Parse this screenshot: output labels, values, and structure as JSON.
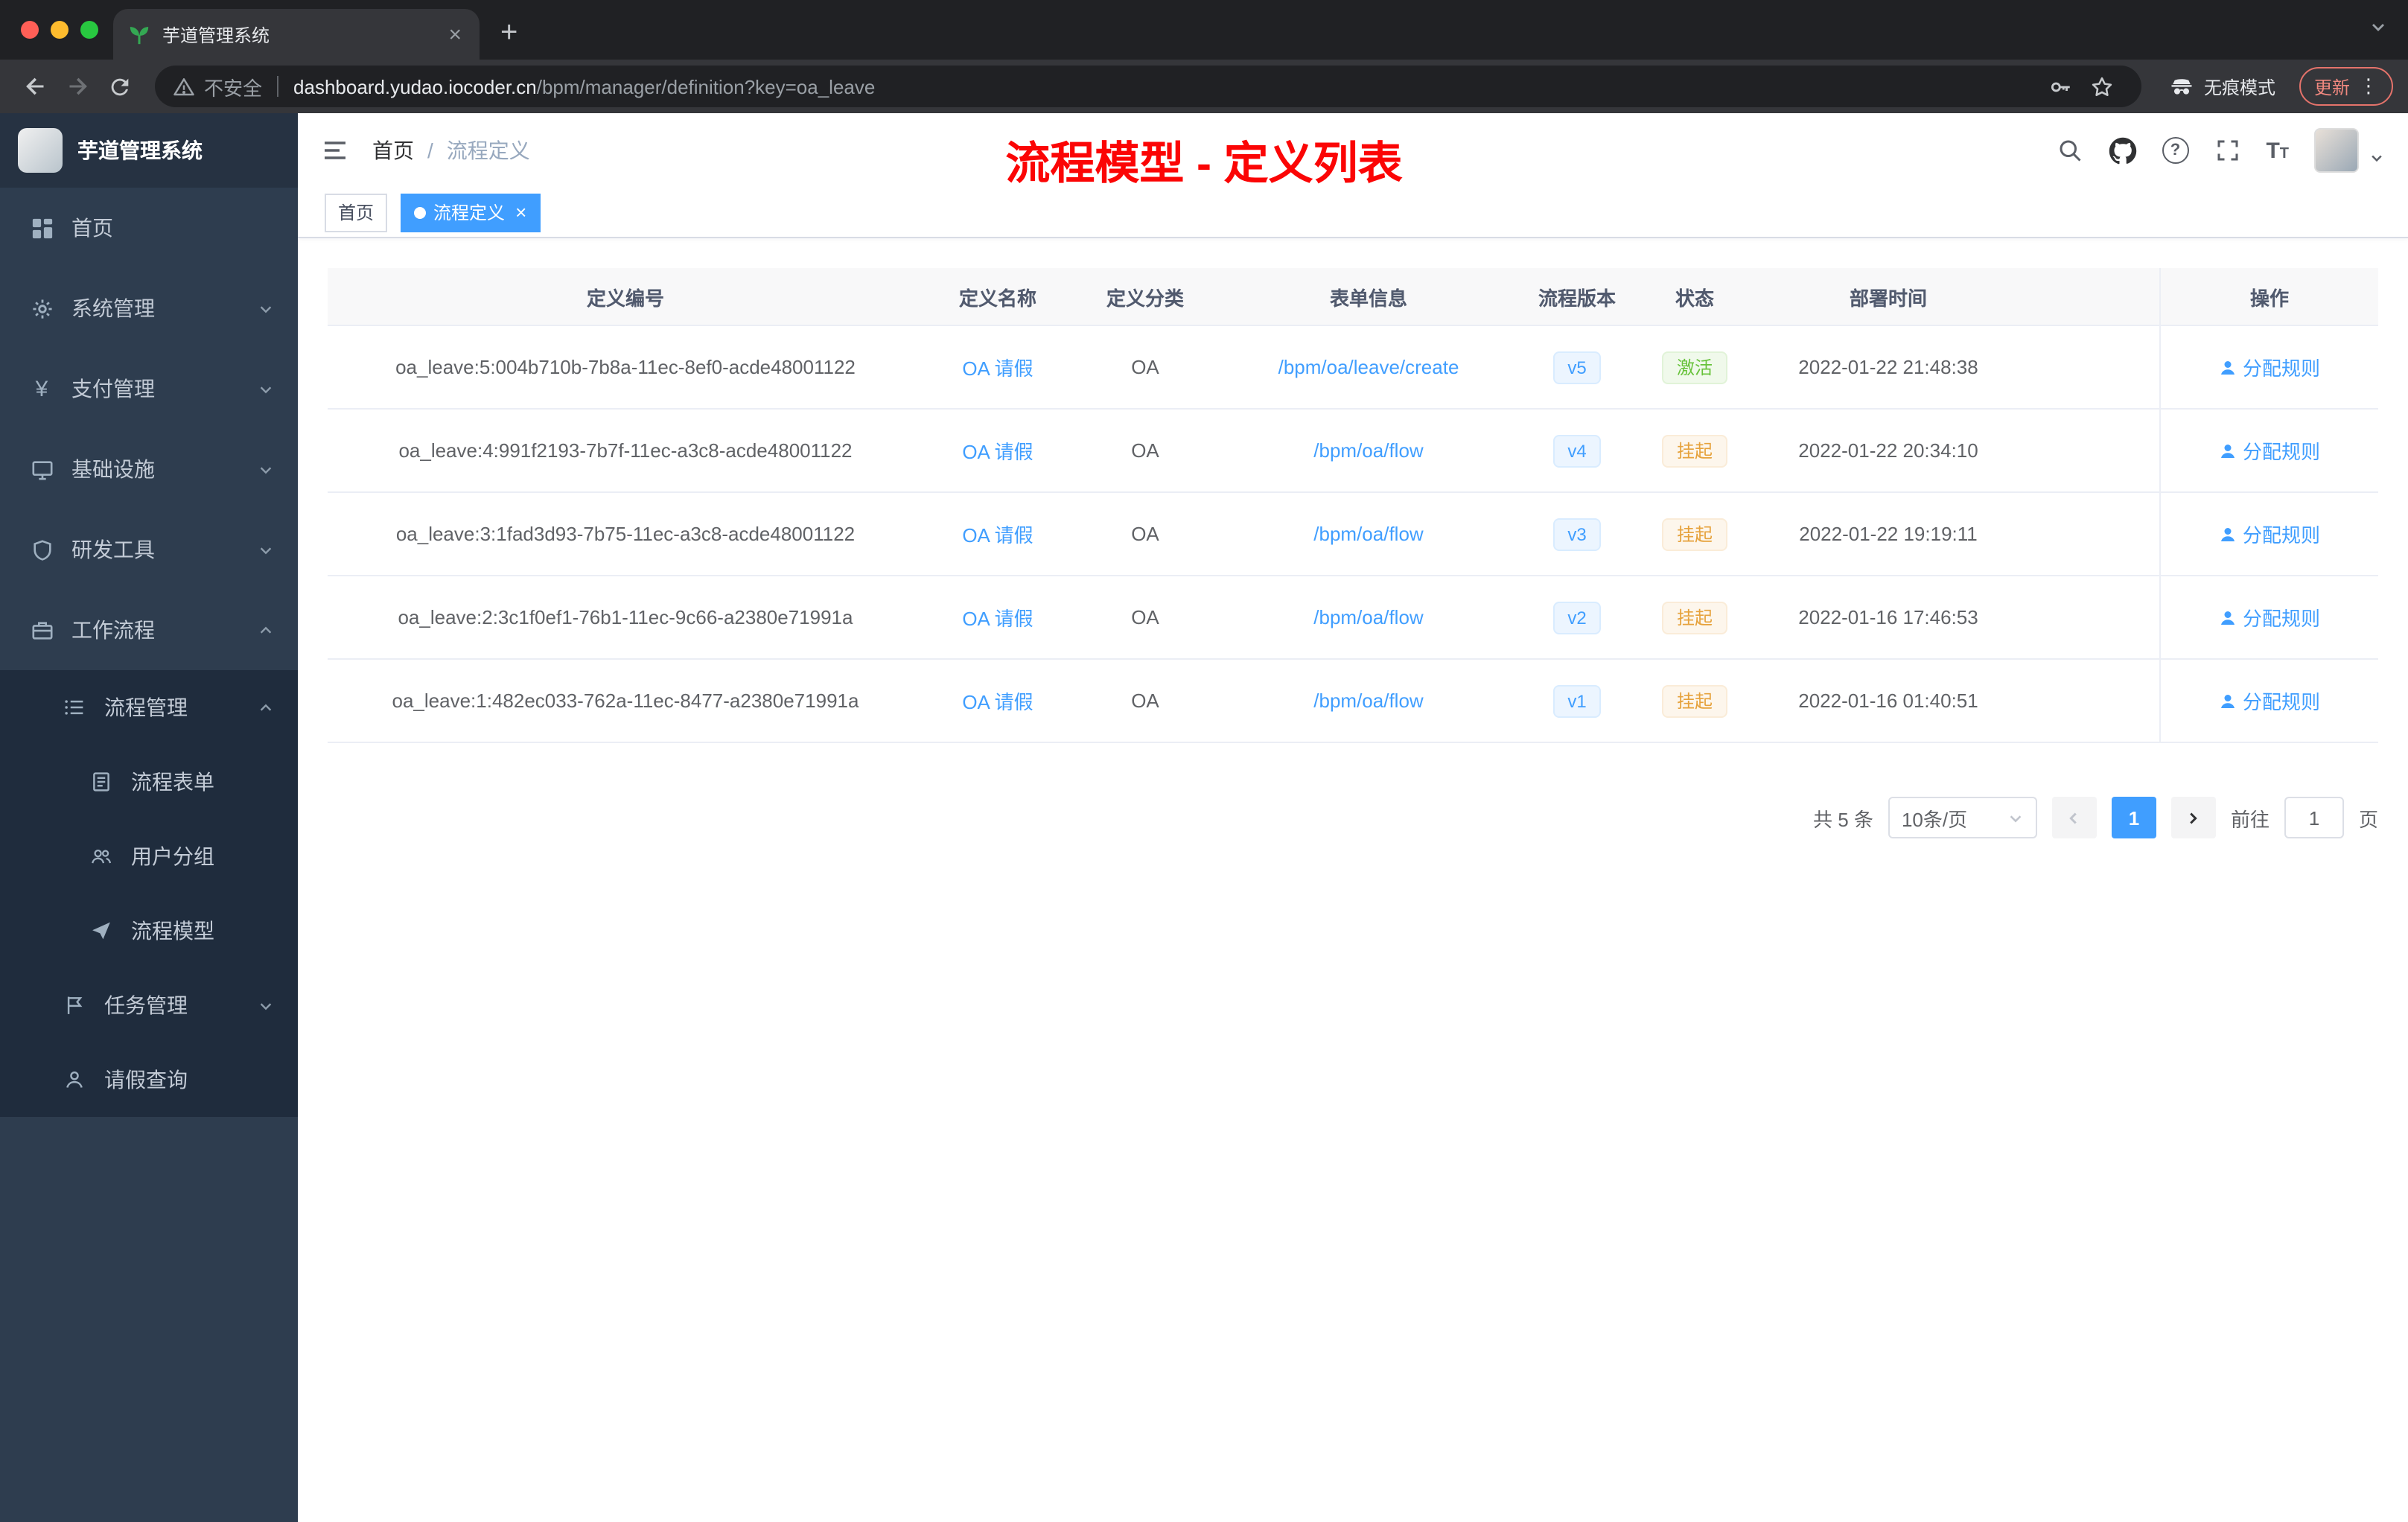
{
  "browser": {
    "tab_title": "芋道管理系统",
    "security_label": "不安全",
    "url_host": "dashboard.yudao.iocoder.cn",
    "url_path": "/bpm/manager/definition?key=oa_leave",
    "incognito_label": "无痕模式",
    "update_label": "更新"
  },
  "sidebar": {
    "logo_title": "芋道管理系统",
    "items": [
      {
        "label": "首页"
      },
      {
        "label": "系统管理"
      },
      {
        "label": "支付管理"
      },
      {
        "label": "基础设施"
      },
      {
        "label": "研发工具"
      },
      {
        "label": "工作流程"
      },
      {
        "label": "流程管理"
      },
      {
        "label": "流程表单"
      },
      {
        "label": "用户分组"
      },
      {
        "label": "流程模型"
      },
      {
        "label": "任务管理"
      },
      {
        "label": "请假查询"
      }
    ]
  },
  "navbar": {
    "breadcrumb_home": "首页",
    "breadcrumb_sep": "/",
    "breadcrumb_current": "流程定义",
    "annotation": "流程模型 - 定义列表"
  },
  "tags": {
    "home": "首页",
    "active": "流程定义"
  },
  "table": {
    "columns": [
      "定义编号",
      "定义名称",
      "定义分类",
      "表单信息",
      "流程版本",
      "状态",
      "部署时间",
      "操作"
    ],
    "rows": [
      {
        "id": "oa_leave:5:004b710b-7b8a-11ec-8ef0-acde48001122",
        "name": "OA 请假",
        "category": "OA",
        "form": "/bpm/oa/leave/create",
        "version": "v5",
        "status": "激活",
        "status_type": "success",
        "time": "2022-01-22 21:48:38",
        "action": "分配规则"
      },
      {
        "id": "oa_leave:4:991f2193-7b7f-11ec-a3c8-acde48001122",
        "name": "OA 请假",
        "category": "OA",
        "form": "/bpm/oa/flow",
        "version": "v4",
        "status": "挂起",
        "status_type": "warning",
        "time": "2022-01-22 20:34:10",
        "action": "分配规则"
      },
      {
        "id": "oa_leave:3:1fad3d93-7b75-11ec-a3c8-acde48001122",
        "name": "OA 请假",
        "category": "OA",
        "form": "/bpm/oa/flow",
        "version": "v3",
        "status": "挂起",
        "status_type": "warning",
        "time": "2022-01-22 19:19:11",
        "action": "分配规则"
      },
      {
        "id": "oa_leave:2:3c1f0ef1-76b1-11ec-9c66-a2380e71991a",
        "name": "OA 请假",
        "category": "OA",
        "form": "/bpm/oa/flow",
        "version": "v2",
        "status": "挂起",
        "status_type": "warning",
        "time": "2022-01-16 17:46:53",
        "action": "分配规则"
      },
      {
        "id": "oa_leave:1:482ec033-762a-11ec-8477-a2380e71991a",
        "name": "OA 请假",
        "category": "OA",
        "form": "/bpm/oa/flow",
        "version": "v1",
        "status": "挂起",
        "status_type": "warning",
        "time": "2022-01-16 01:40:51",
        "action": "分配规则"
      }
    ]
  },
  "pagination": {
    "total": "共 5 条",
    "page_size": "10条/页",
    "current_page": "1",
    "goto_label": "前往",
    "goto_value": "1",
    "page_label": "页"
  },
  "colors": {
    "accent": "#409eff",
    "success": "#67c23a",
    "warning": "#e6a23c",
    "annotation_red": "#fb0505"
  }
}
